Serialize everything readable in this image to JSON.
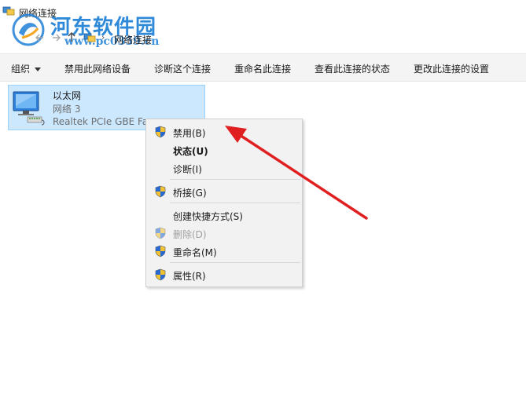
{
  "window": {
    "title": "网络连接"
  },
  "watermark": {
    "name": "河东软件园",
    "url": "www.pc0359.cn"
  },
  "address": {
    "back_icon": "back-arrow-icon",
    "forward_icon": "forward-arrow-icon",
    "up_icon": "up-arrow-icon",
    "separator": "›",
    "crumb": "网络连接"
  },
  "toolbar": {
    "organize": "组织",
    "disable_device": "禁用此网络设备",
    "diagnose": "诊断这个连接",
    "rename": "重命名此连接",
    "view_status": "查看此连接的状态",
    "change_settings": "更改此连接的设置"
  },
  "connection": {
    "name": "以太网",
    "network": "网络  3",
    "device": "Realtek PCIe GBE Fa"
  },
  "context_menu": {
    "items": [
      {
        "label": "禁用(B)",
        "shield": true
      },
      {
        "label": "状态(U)",
        "shield": false
      },
      {
        "label": "诊断(I)",
        "shield": false
      },
      {
        "label": "桥接(G)",
        "shield": true
      },
      {
        "label": "创建快捷方式(S)",
        "shield": false
      },
      {
        "label": "删除(D)",
        "shield": true
      },
      {
        "label": "重命名(M)",
        "shield": true
      },
      {
        "label": "属性(R)",
        "shield": true
      }
    ]
  },
  "colors": {
    "selection_bg": "#cce8ff",
    "selection_border": "#99d1ff",
    "arrow": "#e02020",
    "watermark": "#1e7fd6"
  }
}
